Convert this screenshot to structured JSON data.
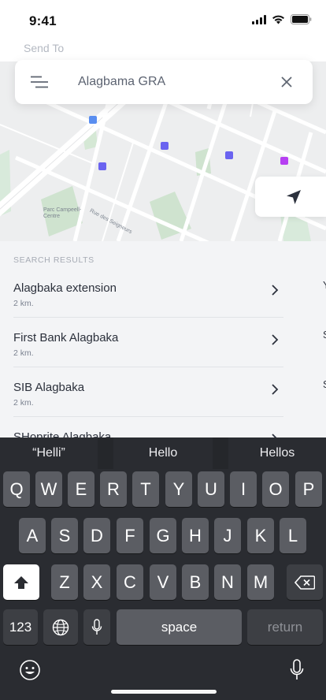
{
  "status_bar": {
    "time": "9:41"
  },
  "header": {
    "send_to_label": "Send To"
  },
  "search": {
    "value": "Alagbama GRA"
  },
  "map": {
    "labels": {
      "park": "Parc Campeell-\nCentre",
      "street": "Rue des Seigneurs"
    },
    "marker_colors": [
      "#5a8ef0",
      "#6a63f0",
      "#6a63f0",
      "#6a63f0",
      "#b63ff2"
    ]
  },
  "results": {
    "header": "SEARCH RESULTS",
    "items": [
      {
        "name": "Alagbaka extension",
        "distance": "2 km."
      },
      {
        "name": "First Bank Alagbaka",
        "distance": "2 km."
      },
      {
        "name": "SIB Alagbaka",
        "distance": "2 km."
      },
      {
        "name": "SHoprite Alagbaka",
        "distance": ""
      }
    ],
    "peek_chars": [
      "Y",
      "S",
      "S"
    ]
  },
  "keyboard": {
    "suggestions": [
      "“Helli”",
      "Hello",
      "Hellos"
    ],
    "row1": [
      "Q",
      "W",
      "E",
      "R",
      "T",
      "Y",
      "U",
      "I",
      "O",
      "P"
    ],
    "row2": [
      "A",
      "S",
      "D",
      "F",
      "G",
      "H",
      "J",
      "K",
      "L"
    ],
    "row3": [
      "Z",
      "X",
      "C",
      "V",
      "B",
      "N",
      "M"
    ],
    "numbers_label": "123",
    "space_label": "space",
    "return_label": "return"
  }
}
